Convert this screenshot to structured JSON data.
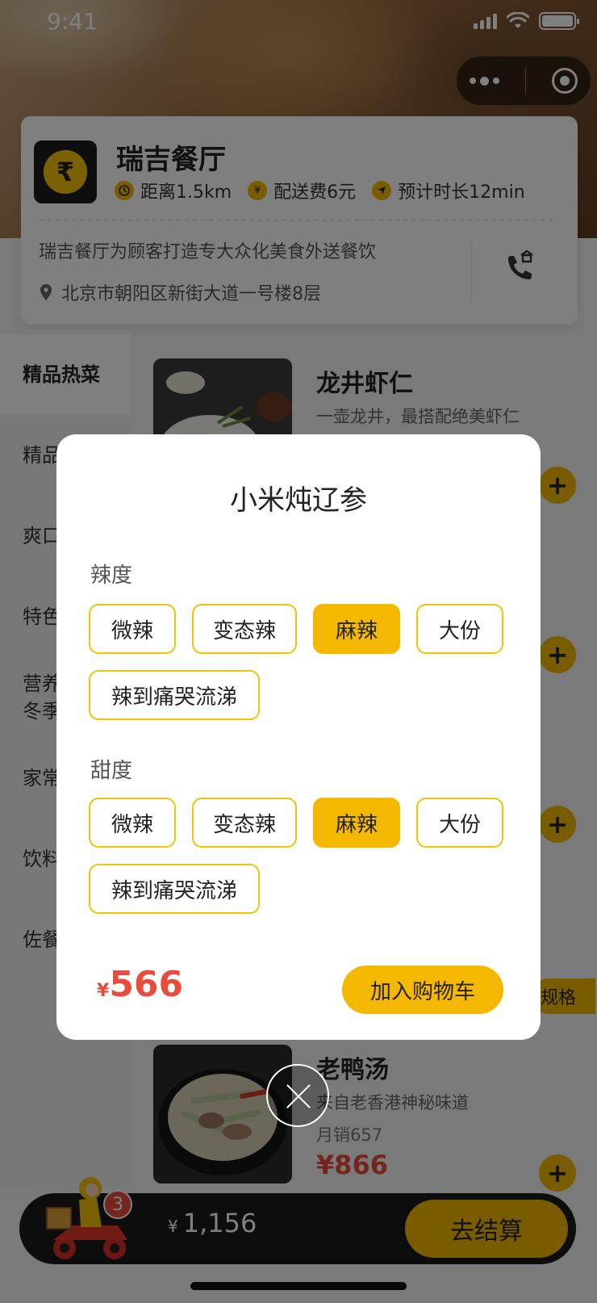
{
  "status_bar": {
    "time": "9:41"
  },
  "store": {
    "name": "瑞吉餐厅",
    "distance": "距离1.5km",
    "delivery_fee": "配送费6元",
    "eta": "预计时长12min",
    "description": "瑞吉餐厅为顾客打造专大众化美食外送餐饮",
    "address": "北京市朝阳区新街大道一号楼8层"
  },
  "categories": [
    {
      "label": "精品热菜",
      "active": true
    },
    {
      "label": "精品"
    },
    {
      "label": "爽口"
    },
    {
      "label": "特色"
    },
    {
      "label": "营养\n冬季"
    },
    {
      "label": "家常"
    },
    {
      "label": "饮料"
    },
    {
      "label": "佐餐"
    }
  ],
  "products": [
    {
      "name": "龙井虾仁",
      "desc": "一壶龙井，最搭配绝美虾仁"
    },
    {
      "name": "老鸭汤",
      "desc": "来自老香港神秘味道",
      "sales": "月销657",
      "price": "¥866"
    }
  ],
  "spec_button_label": "规格",
  "cart": {
    "currency": "¥",
    "total": "1,156",
    "count": "3",
    "checkout_label": "去结算"
  },
  "modal": {
    "title": "小米炖辽参",
    "groups": [
      {
        "label": "辣度",
        "options": [
          "微辣",
          "变态辣",
          "麻辣",
          "大份",
          "辣到痛哭流涕"
        ],
        "selected": "麻辣"
      },
      {
        "label": "甜度",
        "options": [
          "微辣",
          "变态辣",
          "麻辣",
          "大份",
          "辣到痛哭流涕"
        ],
        "selected": "麻辣"
      }
    ],
    "currency": "¥",
    "price": "566",
    "add_to_cart_label": "加入购物车"
  },
  "colors": {
    "accent": "#f5b800",
    "price": "#e84c3d",
    "dark": "#1b1b1b"
  },
  "icons": [
    "clock-icon",
    "yen-icon",
    "navigate-icon",
    "location-pin-icon",
    "phone-icon",
    "more-dots-icon",
    "target-icon",
    "close-icon",
    "plus-icon",
    "delivery-rider-icon"
  ]
}
